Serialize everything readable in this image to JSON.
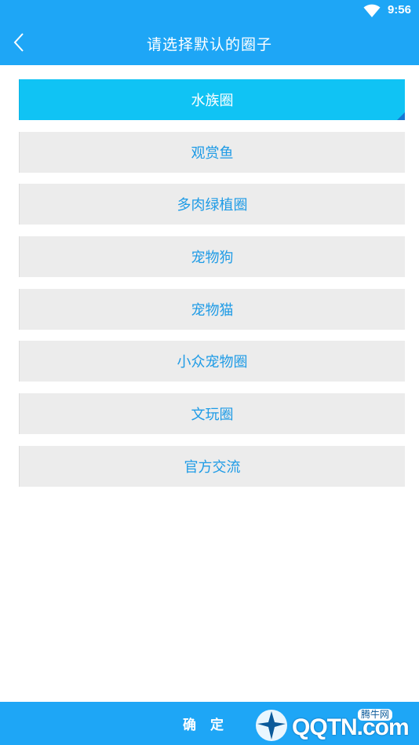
{
  "status_bar": {
    "time": "9:56",
    "wifi_icon": "wifi-icon"
  },
  "header": {
    "title": "请选择默认的圈子",
    "back_icon": "chevron-left-icon"
  },
  "circles": [
    {
      "label": "水族圈",
      "selected": true
    },
    {
      "label": "观赏鱼",
      "selected": false
    },
    {
      "label": "多肉绿植圈",
      "selected": false
    },
    {
      "label": "宠物狗",
      "selected": false
    },
    {
      "label": "宠物猫",
      "selected": false
    },
    {
      "label": "小众宠物圈",
      "selected": false
    },
    {
      "label": "文玩圈",
      "selected": false
    },
    {
      "label": "官方交流",
      "selected": false
    }
  ],
  "footer": {
    "confirm_label": "确 定"
  },
  "watermark": {
    "text": "QQTN.com",
    "sub": "腾牛网"
  },
  "colors": {
    "primary": "#1ea6f6",
    "selected_bg": "#10c3f4",
    "item_bg": "#ececec",
    "item_text": "#1e9be6"
  }
}
